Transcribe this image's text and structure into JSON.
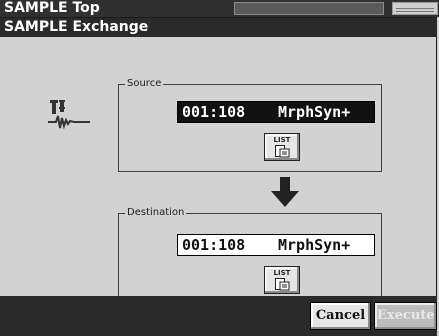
{
  "top_bar": {
    "title": "SAMPLE Top",
    "indicator_text": ""
  },
  "window": {
    "title": "SAMPLE Exchange"
  },
  "source": {
    "legend": "Source",
    "number": "001:108",
    "name": "MrphSyn+",
    "selected": true,
    "list_label": "LIST"
  },
  "destination": {
    "legend": "Destination",
    "number": "001:108",
    "name": "MrphSyn+",
    "list_label": "LIST"
  },
  "buttons": {
    "cancel": "Cancel",
    "execute": "Execute",
    "execute_enabled": false
  },
  "icons": {
    "tool": "sample-edit-icon",
    "arrow": "arrow-down-icon",
    "list": "list-document-icon"
  }
}
